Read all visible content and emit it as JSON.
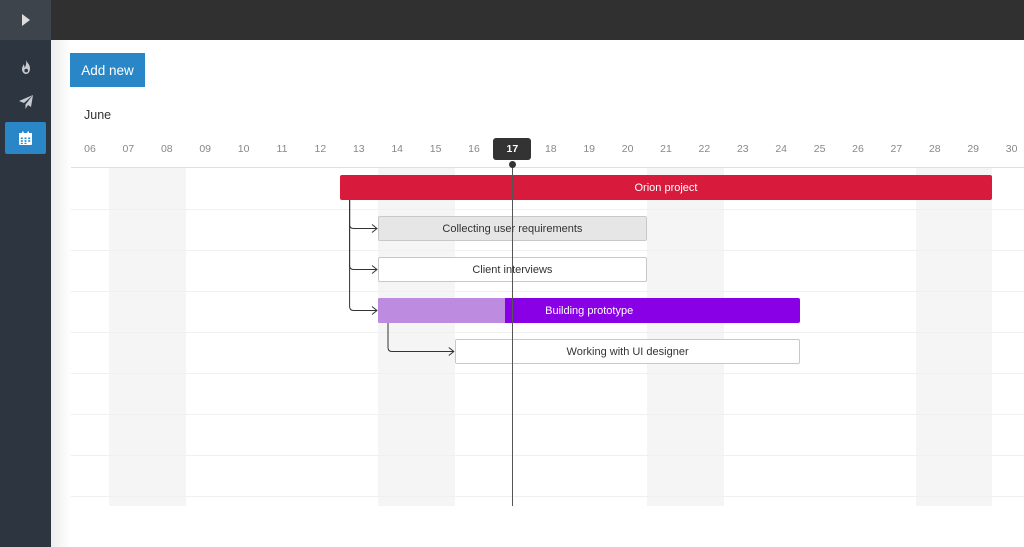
{
  "sidebar": {
    "toggle_icon": "play-icon",
    "items": [
      {
        "name": "fire",
        "icon": "fire-icon",
        "active": false
      },
      {
        "name": "send",
        "icon": "paper-plane-icon",
        "active": false
      },
      {
        "name": "calendar",
        "icon": "calendar-icon",
        "active": true
      }
    ]
  },
  "toolbar": {
    "add_new_label": "Add new"
  },
  "timeline": {
    "month": "June",
    "days": [
      "06",
      "07",
      "08",
      "09",
      "10",
      "11",
      "12",
      "13",
      "14",
      "15",
      "16",
      "17",
      "18",
      "19",
      "20",
      "21",
      "22",
      "23",
      "24",
      "25",
      "26",
      "27",
      "28",
      "29",
      "30"
    ],
    "today": "17",
    "weekend_days": [
      "07",
      "08",
      "14",
      "15",
      "21",
      "22",
      "28",
      "29"
    ]
  },
  "tasks": [
    {
      "name": "Orion project",
      "start": "13",
      "end": "29",
      "row": 0,
      "progress": 0,
      "color": "#d81b3c",
      "text_color": "#ffffff",
      "filled": true
    },
    {
      "name": "Collecting user requirements",
      "start": "14",
      "end": "20",
      "row": 1,
      "progress": 1.0,
      "color": "#e6e6e6",
      "text_color": "#333333",
      "filled": false
    },
    {
      "name": "Client interviews",
      "start": "14",
      "end": "20",
      "row": 2,
      "progress": 0,
      "color": "#ffffff",
      "text_color": "#333333",
      "filled": false
    },
    {
      "name": "Building prototype",
      "start": "14",
      "end": "24",
      "row": 3,
      "progress": 0.3,
      "color": "#8a00e6",
      "progress_color": "#bd8be0",
      "text_color": "#ffffff",
      "filled": true
    },
    {
      "name": "Working with UI designer",
      "start": "16",
      "end": "24",
      "row": 4,
      "progress": 0,
      "color": "#ffffff",
      "text_color": "#333333",
      "filled": false
    }
  ],
  "dependencies": [
    {
      "from": 0,
      "to": 1
    },
    {
      "from": 0,
      "to": 2
    },
    {
      "from": 0,
      "to": 3
    },
    {
      "from": 3,
      "to": 4
    }
  ],
  "colors": {
    "accent": "#2a87c7",
    "sidebar": "#2d3540",
    "topbar": "#303030"
  }
}
